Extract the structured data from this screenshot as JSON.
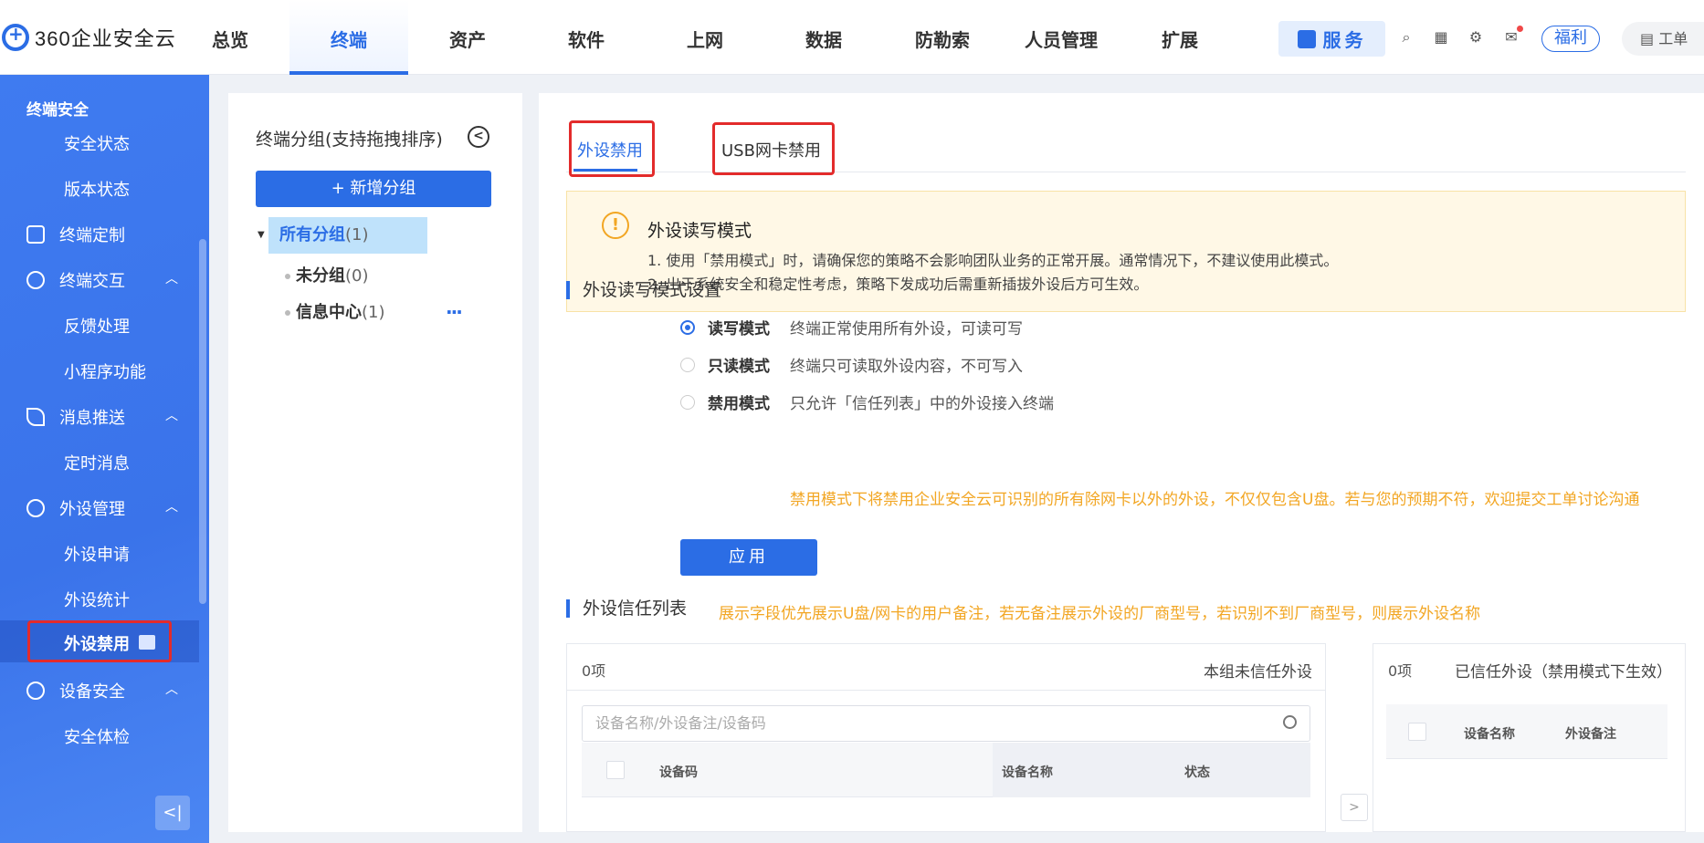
{
  "app": {
    "logo_text": "360企业安全云"
  },
  "nav": {
    "items": [
      "总览",
      "终端",
      "资产",
      "软件",
      "上网",
      "数据",
      "防勒索",
      "人员管理",
      "扩展"
    ],
    "active_index": 1
  },
  "header": {
    "service_label": "服务",
    "fuli_label": "福利",
    "gongdan_label": "工单"
  },
  "sidebar": {
    "section_title": "终端安全",
    "items": {
      "security_status": "安全状态",
      "version_status": "版本状态",
      "terminal_custom": "终端定制",
      "terminal_interact": "终端交互",
      "feedback": "反馈处理",
      "miniprogram": "小程序功能",
      "message_push": "消息推送",
      "scheduled_msg": "定时消息",
      "peripheral_mgmt": "外设管理",
      "peripheral_apply": "外设申请",
      "peripheral_stats": "外设统计",
      "peripheral_disable": "外设禁用",
      "device_security": "设备安全",
      "security_check": "安全体检"
    }
  },
  "groups": {
    "title": "终端分组(支持拖拽排序)",
    "add_label": "+ 新增分组",
    "tree": [
      {
        "name": "所有分组",
        "count": "1"
      },
      {
        "name": "未分组",
        "count": "0"
      },
      {
        "name": "信息中心",
        "count": "1"
      }
    ],
    "more_label": "···"
  },
  "tabs": [
    "外设禁用",
    "USB网卡禁用"
  ],
  "notice": {
    "title": "外设读写模式",
    "line1": "1. 使用「禁用模式」时，请确保您的策略不会影响团队业务的正常开展。通常情况下，不建议使用此模式。",
    "line2": "2. 出于系统安全和稳定性考虑，策略下发成功后需重新插拔外设后方可生效。"
  },
  "mode_settings": {
    "title": "外设读写模式设置",
    "options": [
      {
        "label": "读写模式",
        "desc": "终端正常使用所有外设，可读可写",
        "selected": true
      },
      {
        "label": "只读模式",
        "desc": "终端只可读取外设内容，不可写入",
        "selected": false
      },
      {
        "label": "禁用模式",
        "desc": "只允许「信任列表」中的外设接入终端",
        "selected": false
      }
    ],
    "warning": "禁用模式下将禁用企业安全云可识别的所有除网卡以外的外设，不仅仅包含U盘。若与您的预期不符，欢迎提交工单讨论沟通",
    "apply_label": "应用"
  },
  "trust_list": {
    "title": "外设信任列表",
    "hint": "展示字段优先展示U盘/网卡的用户备注，若无备注展示外设的厂商型号，若识别不到厂商型号，则展示外设名称",
    "left": {
      "count": "0项",
      "title": "本组未信任外设",
      "search_placeholder": "设备名称/外设备注/设备码",
      "columns": [
        "设备码",
        "设备名称",
        "状态"
      ]
    },
    "right": {
      "count": "0项",
      "title": "已信任外设（禁用模式下生效）",
      "columns": [
        "设备名称",
        "外设备注"
      ]
    }
  }
}
